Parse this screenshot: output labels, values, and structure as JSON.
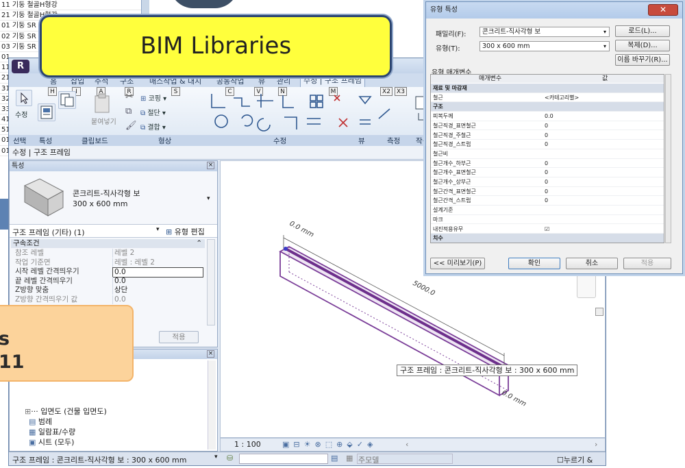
{
  "bg_list": {
    "rows": [
      "11 기둥 철골H형강",
      "21 기둥 철골H형강",
      "01 기둥 SR",
      "02 기둥 SR",
      "03 기둥 SR",
      "01",
      "11",
      "21",
      "31",
      "32",
      "33",
      "41",
      "51",
      "01",
      "01"
    ]
  },
  "banner": {
    "text": "BIM  Libraries"
  },
  "orange_box": {
    "line1": "s",
    "line2": "11"
  },
  "app": {
    "app_button": "R",
    "tabs": [
      "홈",
      "삽입",
      "주석",
      "구조",
      "매스작업 & 대지",
      "공동작업",
      "뷰",
      "관리",
      "수정 | 구조 프레임"
    ],
    "keytips": [
      "H",
      "I",
      "A",
      "R",
      "S",
      "C",
      "V",
      "N",
      "M",
      "X2",
      "X3"
    ],
    "ribbon_labels": {
      "modify": "수정",
      "paste": "붙여넣기",
      "cope": "코핑",
      "cut": "절단",
      "join": "결합"
    },
    "ribbon_groups": [
      "선택",
      "특성",
      "클립보드",
      "형상",
      "수정",
      "뷰",
      "측정",
      "작성"
    ],
    "context_bar": "수정 | 구조 프레임"
  },
  "properties": {
    "header": "특성",
    "type_name_line1": "콘크리트-직사각형 보",
    "type_name_line2": "300 x 600 mm",
    "instance_filter": "구조 프레임 (기타) (1)",
    "edit_type": "유형 편집",
    "section": "구속조건",
    "rows": [
      {
        "k": "참조 레벨",
        "v": "레벨 2",
        "muted": true
      },
      {
        "k": "작업 기준면",
        "v": "레벨 : 레벨 2",
        "muted": true
      },
      {
        "k": "시작 레벨 간격띄우기",
        "v": "0.0",
        "muted": false
      },
      {
        "k": "끝 레벨 간격띄우기",
        "v": "0.0",
        "muted": false
      },
      {
        "k": "Z방향 맞춤",
        "v": "상단",
        "muted": false
      },
      {
        "k": "Z방향 간격띄우기 값",
        "v": "0.0",
        "muted": true
      }
    ],
    "apply": "적용"
  },
  "browser": {
    "items": [
      "입면도 (건물 입면도)",
      "범례",
      "일람표/수량",
      "시트 (모두)"
    ]
  },
  "view": {
    "dim_left": "0.0 mm",
    "dim_length": "5000.0",
    "dim_right": "0.0 mm",
    "tooltip": "구조 프레임 : 콘크리트-직사각형 보 : 300 x 600 mm",
    "scale": "1 : 100"
  },
  "status": {
    "text": "구조 프레임 : 콘크리트-직사각형 보 : 300 x 600 mm",
    "model": "주모델",
    "press_drag": "누르기 &"
  },
  "dialog": {
    "title": "유형 특성",
    "family_label": "패밀리(F):",
    "family_value": "콘크리트-직사각형 보",
    "type_label": "유형(T):",
    "type_value": "300 x 600 mm",
    "load": "로드(L)...",
    "duplicate": "복제(D)...",
    "rename": "이름 바꾸기(R)...",
    "section_label": "유형 매개변수",
    "col_param": "매개변수",
    "col_value": "값",
    "rows": [
      {
        "k": "재료 및 마감재",
        "v": "",
        "cat": true
      },
      {
        "k": "철근",
        "v": "<카테고리별>",
        "cat": false
      },
      {
        "k": "구조",
        "v": "",
        "cat": true
      },
      {
        "k": "피복두께",
        "v": "0.0",
        "cat": false
      },
      {
        "k": "철근직경_표면철근",
        "v": "0",
        "cat": false
      },
      {
        "k": "철근직경_주철근",
        "v": "0",
        "cat": false
      },
      {
        "k": "철근직경_스트럽",
        "v": "0",
        "cat": false
      },
      {
        "k": "철근비",
        "v": "",
        "cat": false
      },
      {
        "k": "철근개수_하부근",
        "v": "0",
        "cat": false
      },
      {
        "k": "철근개수_표면철근",
        "v": "0",
        "cat": false
      },
      {
        "k": "철근개수_상부근",
        "v": "0",
        "cat": false
      },
      {
        "k": "철근간격_표면철근",
        "v": "0",
        "cat": false
      },
      {
        "k": "철근간격_스트럽",
        "v": "0",
        "cat": false
      },
      {
        "k": "설계기준",
        "v": "",
        "cat": false
      },
      {
        "k": "마크",
        "v": "",
        "cat": false
      },
      {
        "k": "내진적용유무",
        "v": "☑",
        "cat": false
      },
      {
        "k": "치수",
        "v": "",
        "cat": true
      }
    ],
    "preview": "<< 미리보기(P)",
    "ok": "확인",
    "cancel": "취소",
    "apply": "적용"
  }
}
